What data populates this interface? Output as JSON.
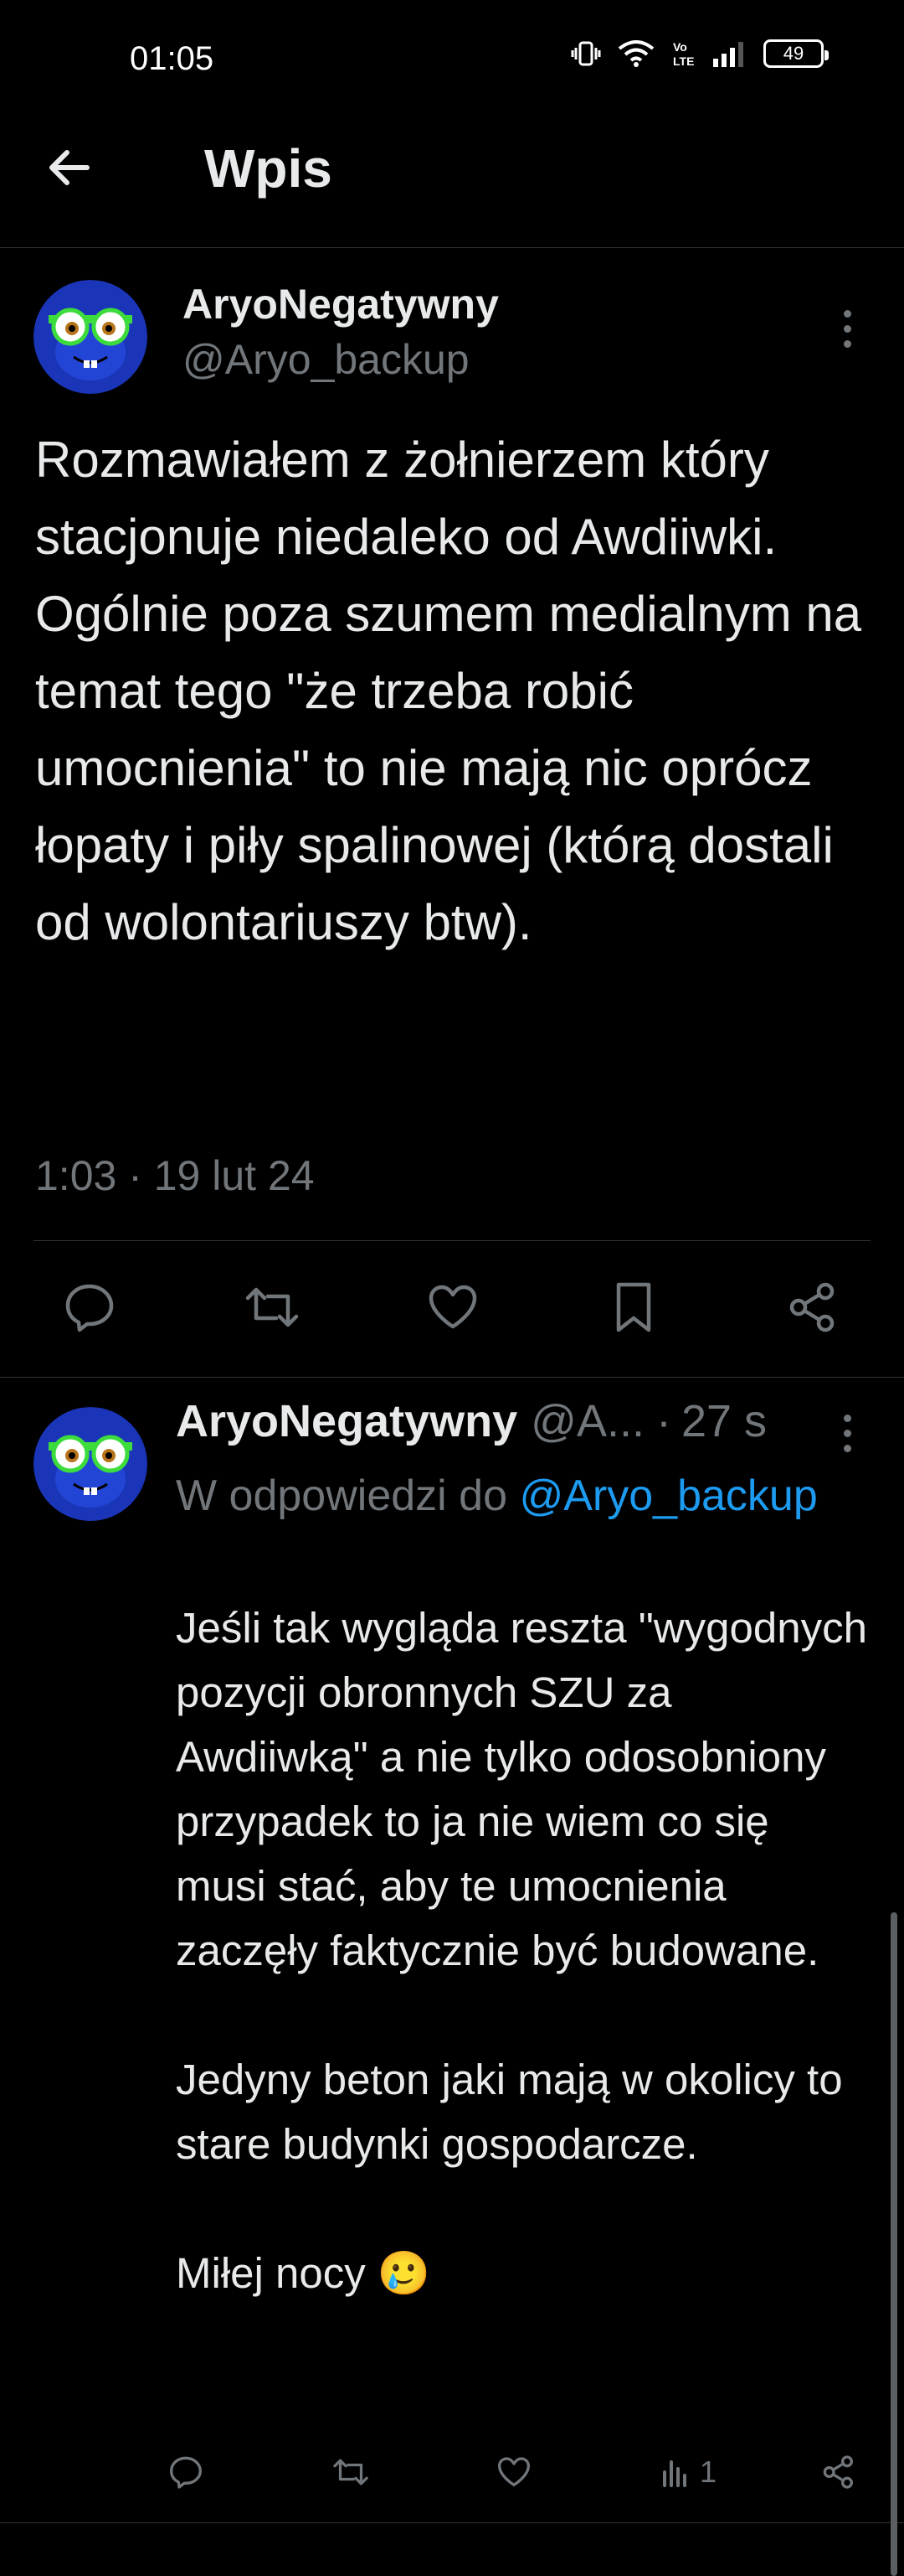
{
  "status_bar": {
    "time": "01:05",
    "battery": "49",
    "icons": [
      "vibrate-icon",
      "wifi-icon",
      "volte-icon",
      "signal-icon",
      "battery-icon"
    ]
  },
  "header": {
    "title": "Wpis",
    "back_icon": "arrow-left-icon"
  },
  "main_tweet": {
    "display_name": "AryoNegatywny",
    "handle": "@Aryo_backup",
    "text": "Rozmawiałem z żołnierzem który stacjonuje niedaleko od Awdiiwki. Ogólnie poza szumem medialnym na temat tego \"że trzeba robić umocnienia\" to nie mają nic oprócz łopaty i piły spalinowej (którą dostali od wolontariuszy btw).",
    "timestamp": "1:03 · 19 lut 24",
    "actions": [
      "reply-icon",
      "retweet-icon",
      "like-icon",
      "bookmark-icon",
      "share-icon"
    ]
  },
  "reply": {
    "display_name": "AryoNegatywny",
    "handle": "@A...",
    "separator": "·",
    "time": "27 s",
    "reply_to_prefix": "W odpowiedzi do ",
    "reply_to_handle": "@Aryo_backup",
    "text": "Jeśli tak wygląda reszta \"wygodnych pozycji obronnych SZU za Awdiiwką\" a nie tylko odosobniony przypadek to ja nie wiem co się musi stać, aby te umocnienia zaczęły faktycznie być budowane.\n\nJedyny beton jaki mają w okolicy to stare budynki gospodarcze.\n\nMiłej nocy 🥲",
    "views_count": "1"
  },
  "colors": {
    "background": "#000000",
    "text_primary": "#e7e9ea",
    "text_secondary": "#71767b",
    "link": "#1d9bf0",
    "divider": "#2f3336",
    "avatar_bg": "#1a35b8"
  }
}
